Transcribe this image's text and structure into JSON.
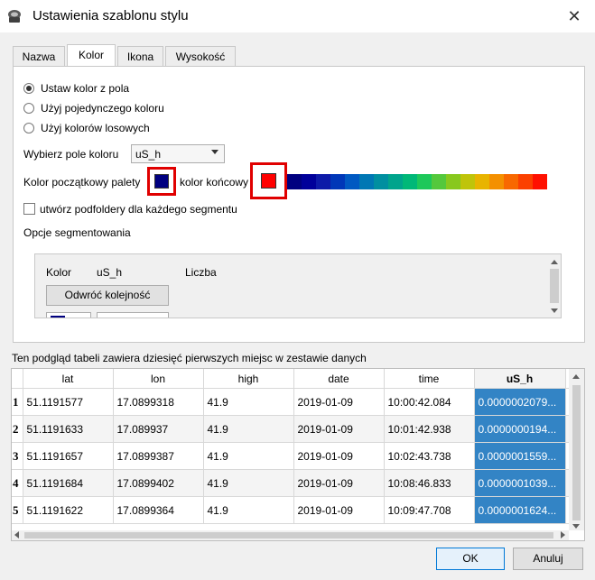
{
  "window": {
    "title": "Ustawienia szablonu stylu"
  },
  "tabs": [
    {
      "label": "Nazwa"
    },
    {
      "label": "Kolor"
    },
    {
      "label": "Ikona"
    },
    {
      "label": "Wysokość"
    }
  ],
  "color_mode": {
    "options": [
      "Ustaw kolor z pola",
      "Użyj pojedynczego koloru",
      "Użyj kolorów losowych"
    ],
    "selected_index": 0
  },
  "color_field": {
    "label": "Wybierz pole koloru",
    "value": "uS_h"
  },
  "palette": {
    "start_label": "Kolor początkowy palety",
    "end_label": "kolor końcowy",
    "start_color": "#000080",
    "end_color": "#ff0000",
    "ramp_colors": [
      "#000080",
      "#00009a",
      "#0d1aa8",
      "#0037b8",
      "#0059c2",
      "#0077b4",
      "#008fa0",
      "#00a48c",
      "#00b878",
      "#1ec85a",
      "#54c83c",
      "#88c81e",
      "#bfc40a",
      "#e8b400",
      "#f49000",
      "#f86800",
      "#fb4000",
      "#ff1000"
    ]
  },
  "subfolders": {
    "label": "utwórz podfoldery dla każdego segmentu",
    "checked": false
  },
  "segmentation": {
    "group_label": "Opcje segmentowania",
    "col_color": "Kolor",
    "col_field": "uS_h",
    "col_count": "Liczba",
    "reverse_button": "Odwróć kolejność"
  },
  "preview": {
    "caption": "Ten podgląd tabeli zawiera dziesięć pierwszych miejsc w zestawie danych",
    "columns": [
      "lat",
      "lon",
      "high",
      "date",
      "time",
      "uS_h"
    ],
    "extra_column": "1",
    "rows": [
      {
        "n": "1",
        "lat": "51.1191577",
        "lon": "17.0899318",
        "high": "41.9",
        "date": "2019-01-09",
        "time": "10:00:42.084",
        "uS_h": "0.0000002079..."
      },
      {
        "n": "2",
        "lat": "51.1191633",
        "lon": "17.089937",
        "high": "41.9",
        "date": "2019-01-09",
        "time": "10:01:42.938",
        "uS_h": "0.0000000194..."
      },
      {
        "n": "3",
        "lat": "51.1191657",
        "lon": "17.0899387",
        "high": "41.9",
        "date": "2019-01-09",
        "time": "10:02:43.738",
        "uS_h": "0.0000001559..."
      },
      {
        "n": "4",
        "lat": "51.1191684",
        "lon": "17.0899402",
        "high": "41.9",
        "date": "2019-01-09",
        "time": "10:08:46.833",
        "uS_h": "0.0000001039..."
      },
      {
        "n": "5",
        "lat": "51.1191622",
        "lon": "17.0899364",
        "high": "41.9",
        "date": "2019-01-09",
        "time": "10:09:47.708",
        "uS_h": "0.0000001624..."
      }
    ]
  },
  "buttons": {
    "ok": "OK",
    "cancel": "Anuluj"
  }
}
